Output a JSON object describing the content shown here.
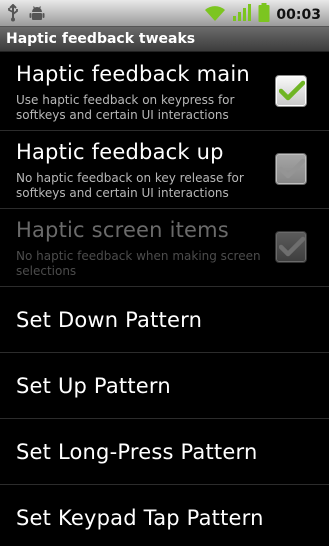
{
  "status_bar": {
    "time": "00:03",
    "icons": [
      "usb-icon",
      "android-debug-icon",
      "wifi-icon",
      "signal-icon",
      "battery-icon"
    ],
    "colors": {
      "wifi": "#7cc520",
      "signal": "#7cc520",
      "battery": "#7cc520"
    }
  },
  "title": "Haptic feedback tweaks",
  "checkbox_prefs": [
    {
      "title": "Haptic feedback main",
      "summary": "Use haptic feedback on keypress for softkeys and certain UI interactions",
      "checked": true,
      "enabled": true
    },
    {
      "title": "Haptic feedback up",
      "summary": "No haptic feedback on key release for softkeys and certain UI interactions",
      "checked": true,
      "enabled": true
    },
    {
      "title": "Haptic screen items",
      "summary": "No haptic feedback when making screen selections",
      "checked": true,
      "enabled": false
    }
  ],
  "pattern_items": [
    {
      "title": "Set Down Pattern"
    },
    {
      "title": "Set Up Pattern"
    },
    {
      "title": "Set Long-Press Pattern"
    },
    {
      "title": "Set Keypad Tap Pattern"
    }
  ]
}
